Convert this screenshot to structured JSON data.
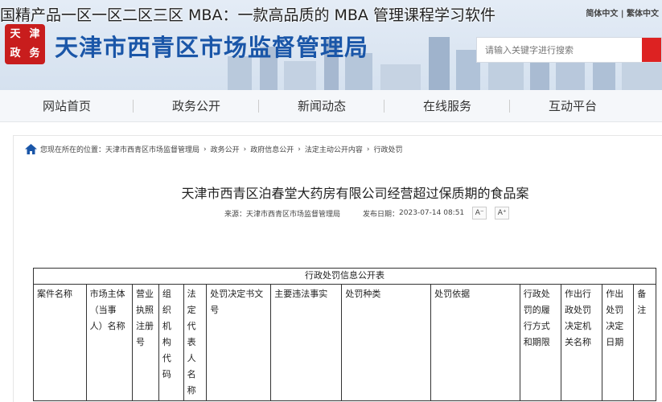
{
  "overlay": {
    "title": "国精产品一区一区二区三区 MBA：一款高品质的 MBA 管理课程学习软件"
  },
  "header": {
    "logo_chars": [
      "天",
      "津",
      "政",
      "务"
    ],
    "site_title": "天津市西青区市场监督管理局",
    "lang_links": "简体中文 | 繁体中文",
    "search_placeholder": "请输入关键字进行搜索",
    "colors": {
      "title": "#1a56a8",
      "search_button": "#dd2222"
    }
  },
  "nav": {
    "items": [
      "网站首页",
      "政务公开",
      "新闻动态",
      "在线服务",
      "互动平台"
    ]
  },
  "breadcrumb": {
    "prefix": "您现在所在的位置：",
    "items": [
      "天津市西青区市场监督管理局",
      "政务公开",
      "政府信息公开",
      "法定主动公开内容",
      "行政处罚"
    ],
    "separator": "›"
  },
  "article": {
    "title": "天津市西青区泊春堂大药房有限公司经营超过保质期的食品案",
    "source_label": "来源：",
    "source": "天津市西青区市场监督管理局",
    "date_label": "发布日期：",
    "date": "2023-07-14 08:51",
    "font_decrease": "A⁻",
    "font_increase": "A⁺"
  },
  "table": {
    "caption": "行政处罚信息公开表",
    "headers": [
      "案件名称",
      "市场主体（当事人）名称",
      "营业执照注册号",
      "组织机构代码",
      "法定代表人名称",
      "处罚决定书文号",
      "主要违法事实",
      "处罚种类",
      "处罚依据",
      "行政处罚的履行方式和期限",
      "作出行政处罚决定机关名称",
      "作出处罚决定日期",
      "备注"
    ]
  }
}
